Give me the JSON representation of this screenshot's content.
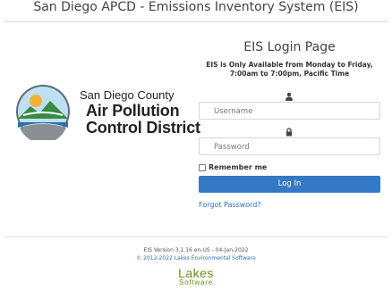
{
  "header": {
    "title": "San Diego APCD - Emissions Inventory System (EIS)"
  },
  "logo": {
    "line1": "San Diego County",
    "line2": "Air Pollution",
    "line3": "Control District"
  },
  "login": {
    "heading": "EIS Login Page",
    "notice": "EIS is Only Available from Monday to Friday, 7:00am to 7:00pm, Pacific Time",
    "username_placeholder": "Username",
    "password_placeholder": "Password",
    "remember_label": "Remember me",
    "login_button": "Log In",
    "forgot_link": "Forgot Password?"
  },
  "footer": {
    "version": "EIS Version 3.1.16 en-US - 04-Jan-2022",
    "copyright": "© 2012-2022 Lakes Environmental Software",
    "vendor_logo_word": "Lakes",
    "vendor_logo_sub": "Software"
  },
  "colors": {
    "primary": "#3479c6",
    "link": "#2d6fb7",
    "vendor": "#6b8e23"
  }
}
